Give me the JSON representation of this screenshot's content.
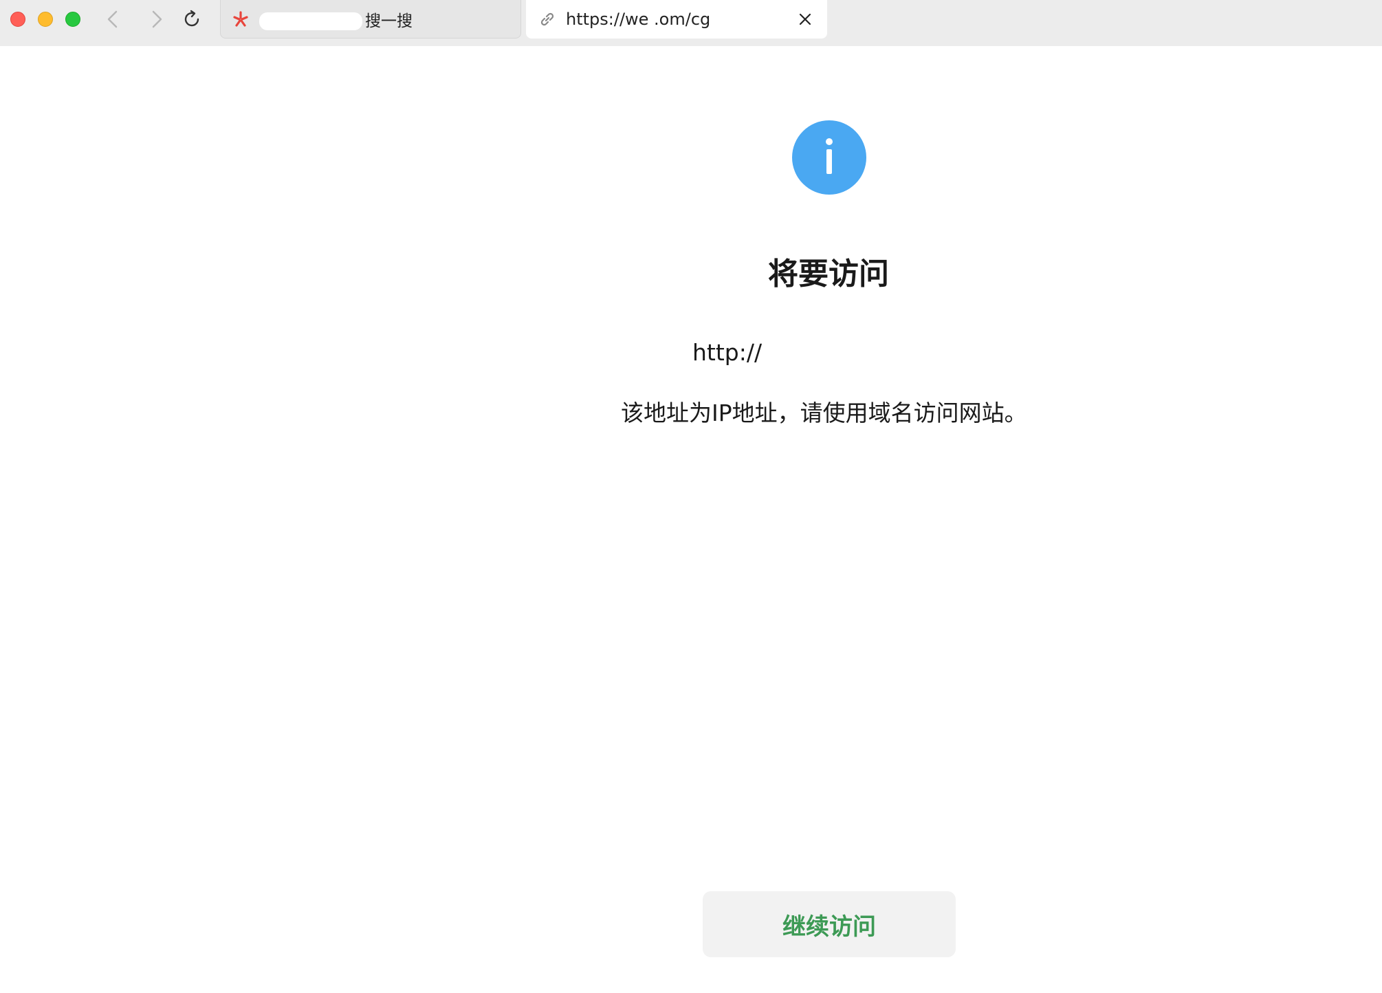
{
  "browser": {
    "tabs": [
      {
        "title": "搜一搜",
        "active": false
      },
      {
        "title": "https://we         .om/cg",
        "active": true
      }
    ]
  },
  "page": {
    "heading": "将要访问",
    "url": "http://",
    "description": "该地址为IP地址，请使用域名访问网站。",
    "continue_label": "继续访问"
  },
  "colors": {
    "info_icon": "#4aa8f2",
    "continue_text": "#3d9a55",
    "button_bg": "#f2f2f2"
  }
}
